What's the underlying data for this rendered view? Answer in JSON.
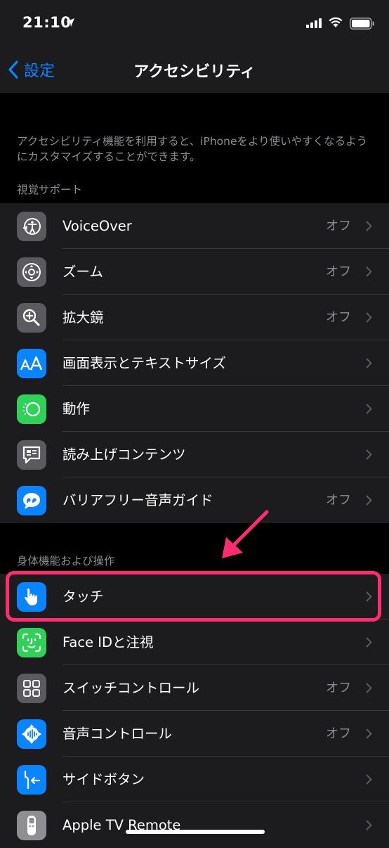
{
  "status_bar": {
    "time": "21:10"
  },
  "nav": {
    "back_label": "設定",
    "title": "アクセシビリティ"
  },
  "description": "アクセシビリティ機能を利用すると、iPhoneをより使いやすくなるようにカスタマイズすることができます。",
  "sections": [
    {
      "header": "視覚サポート",
      "items": [
        {
          "label": "VoiceOver",
          "value": "オフ",
          "icon": "voiceover-icon"
        },
        {
          "label": "ズーム",
          "value": "オフ",
          "icon": "zoom-icon"
        },
        {
          "label": "拡大鏡",
          "value": "オフ",
          "icon": "magnifier-icon"
        },
        {
          "label": "画面表示とテキストサイズ",
          "value": "",
          "icon": "text-size-icon"
        },
        {
          "label": "動作",
          "value": "",
          "icon": "motion-icon"
        },
        {
          "label": "読み上げコンテンツ",
          "value": "",
          "icon": "spoken-content-icon"
        },
        {
          "label": "バリアフリー音声ガイド",
          "value": "オフ",
          "icon": "audio-description-icon"
        }
      ]
    },
    {
      "header": "身体機能および操作",
      "items": [
        {
          "label": "タッチ",
          "value": "",
          "icon": "touch-hand-icon"
        },
        {
          "label": "Face IDと注視",
          "value": "",
          "icon": "face-id-icon"
        },
        {
          "label": "スイッチコントロール",
          "value": "オフ",
          "icon": "switch-control-icon"
        },
        {
          "label": "音声コントロール",
          "value": "オフ",
          "icon": "voice-control-icon"
        },
        {
          "label": "サイドボタン",
          "value": "",
          "icon": "side-button-icon"
        },
        {
          "label": "Apple TV Remote",
          "value": "",
          "icon": "apple-tv-remote-icon"
        }
      ]
    }
  ],
  "colors": {
    "accent": "#0a84ff",
    "highlight": "#ff2d6f",
    "green": "#30d158",
    "gray_icon": "#5a5a5f"
  }
}
